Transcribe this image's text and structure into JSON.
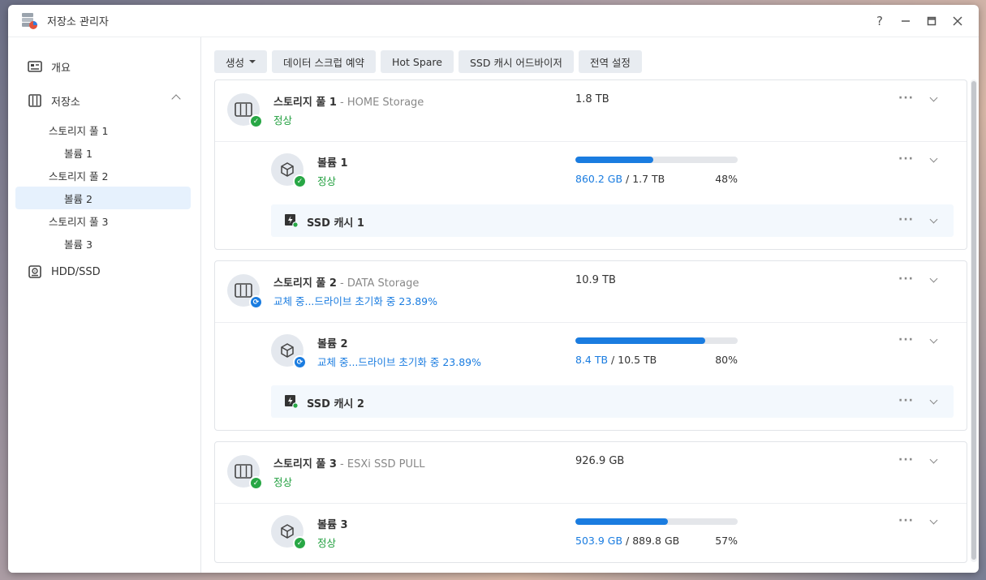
{
  "window": {
    "title": "저장소 관리자",
    "controls": [
      "?",
      "minimize",
      "maximize",
      "close"
    ]
  },
  "sidebar": {
    "overview": "개요",
    "storage": "저장소",
    "pools": [
      {
        "label": "스토리지 풀 1",
        "volume": "볼륨 1"
      },
      {
        "label": "스토리지 풀 2",
        "volume": "볼륨 2"
      },
      {
        "label": "스토리지 풀 3",
        "volume": "볼륨 3"
      }
    ],
    "hdd": "HDD/SSD"
  },
  "toolbar": {
    "create": "생성",
    "scrub": "데이터 스크럽 예약",
    "hotspare": "Hot Spare",
    "ssd_advisor": "SSD 캐시 어드바이저",
    "global": "전역 설정"
  },
  "pools": [
    {
      "name": "스토리지 풀 1",
      "desc": " - HOME Storage",
      "status": "정상",
      "capacity": "1.8 TB",
      "volume": {
        "name": "볼륨 1",
        "status": "정상",
        "used": "860.2 GB",
        "total": " / 1.7 TB",
        "percent": "48%",
        "fraction": 0.48
      },
      "cache": "SSD 캐시 1"
    },
    {
      "name": "스토리지 풀 2",
      "desc": " - DATA Storage",
      "status": "교체 중...드라이브 초기화 중 23.89%",
      "capacity": "10.9 TB",
      "volume": {
        "name": "볼륨 2",
        "status": "교체 중...드라이브 초기화 중 23.89%",
        "used": "8.4 TB",
        "total": " / 10.5 TB",
        "percent": "80%",
        "fraction": 0.8
      },
      "cache": "SSD 캐시 2"
    },
    {
      "name": "스토리지 풀 3",
      "desc": " - ESXi SSD PULL",
      "status": "정상",
      "capacity": "926.9 GB",
      "volume": {
        "name": "볼륨 3",
        "status": "정상",
        "used": "503.9 GB",
        "total": " / 889.8 GB",
        "percent": "57%",
        "fraction": 0.57
      }
    }
  ],
  "colors": {
    "accent": "#1a7ce0",
    "ok": "#1e9e3c",
    "selected_bg": "#e6f1fd"
  }
}
